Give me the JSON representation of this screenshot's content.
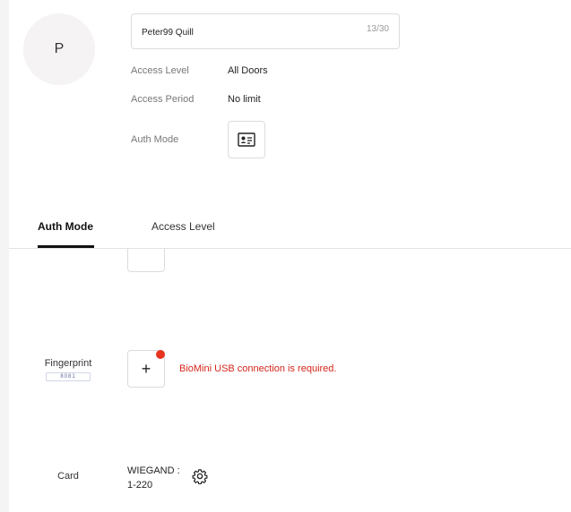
{
  "user": {
    "avatar_initial": "P",
    "name": "Peter99 Quill",
    "name_count": "13/30"
  },
  "info": {
    "access_level_label": "Access Level",
    "access_level_value": "All Doors",
    "access_period_label": "Access Period",
    "access_period_value": "No limit",
    "auth_mode_label": "Auth Mode",
    "auth_mode_icon": "id-card-icon"
  },
  "tabs": [
    {
      "label": "Auth Mode",
      "active": true
    },
    {
      "label": "Access Level",
      "active": false
    }
  ],
  "fingerprint": {
    "label": "Fingerprint",
    "chip": "8081",
    "add_label": "+",
    "warning": "BioMini USB connection is required.",
    "warning_color": "#d3261b",
    "dot_color": "#e8331f"
  },
  "card": {
    "label": "Card",
    "wiegand_line1": "WIEGAND :",
    "wiegand_line2": "1-220",
    "settings_icon": "gear-icon"
  }
}
